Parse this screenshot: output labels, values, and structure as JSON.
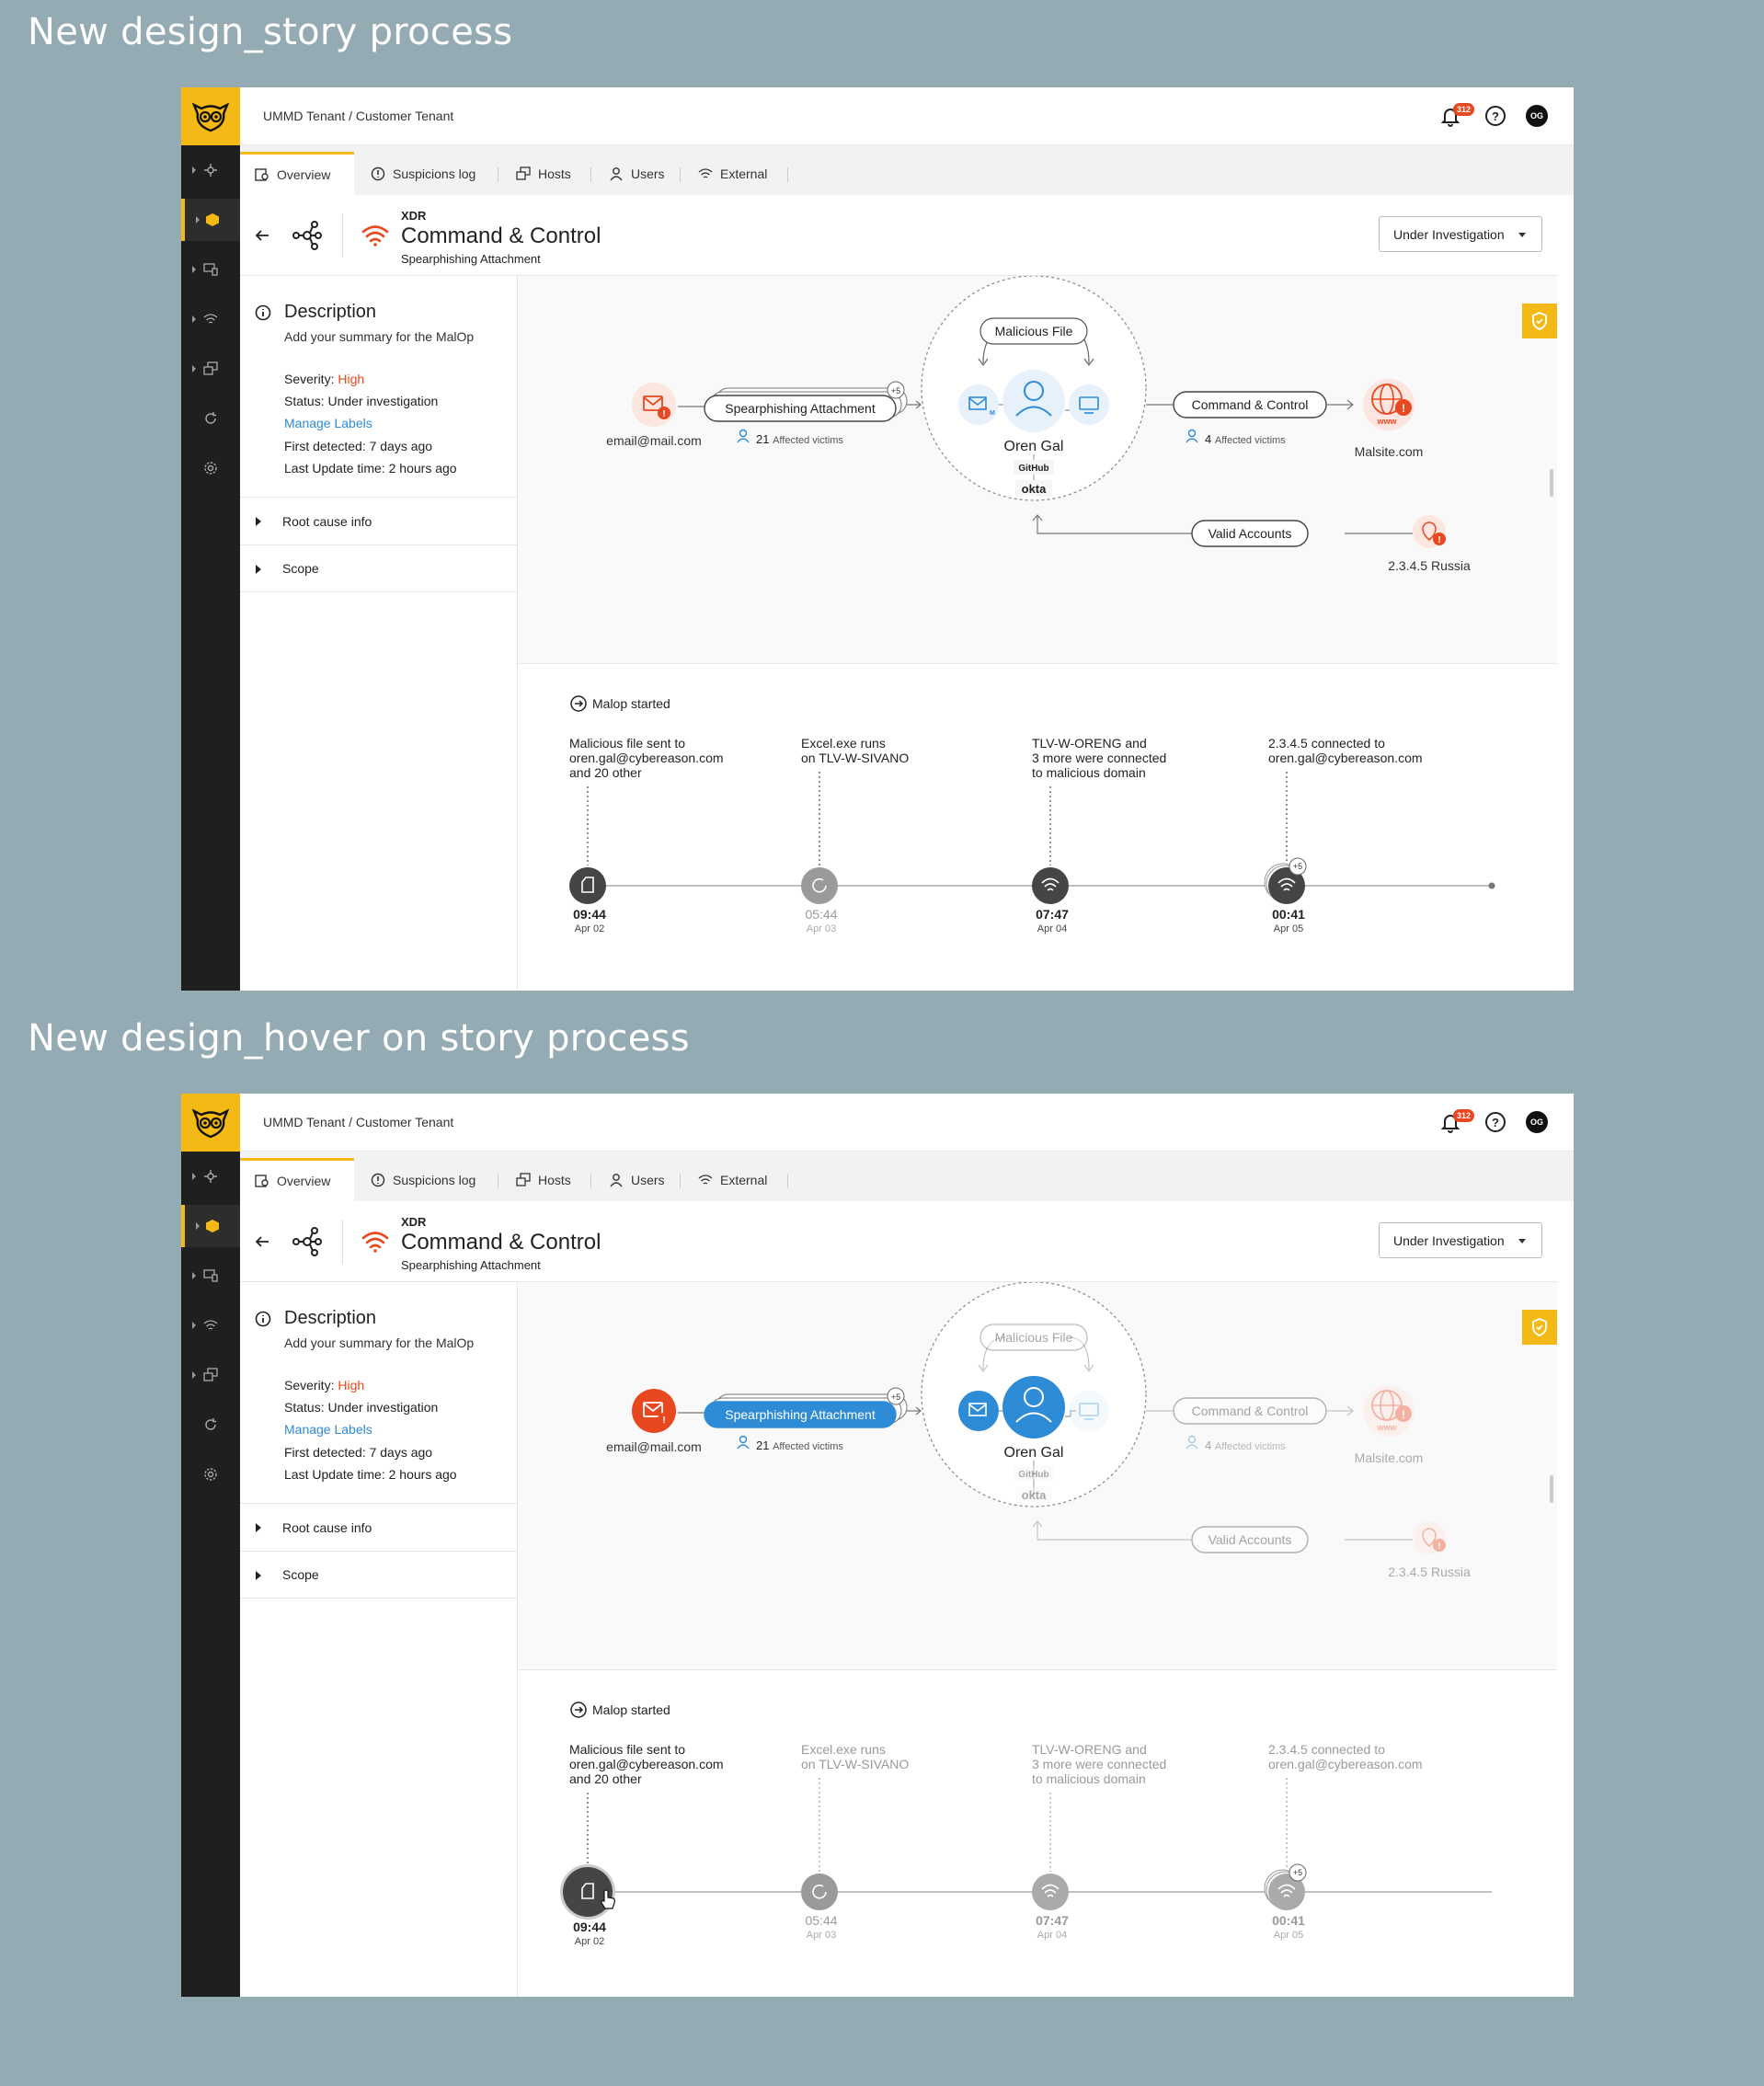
{
  "colors": {
    "accent": "#f5b916",
    "danger": "#e8481f",
    "primary": "#2e8bd6",
    "sidebar": "#1f1f1f",
    "background": "#94abb3"
  },
  "screens": [
    {
      "title": "New design_story process",
      "topbar": {
        "breadcrumb": "UMMD Tenant / Customer Tenant",
        "notifications": "312",
        "avatar": "OG"
      },
      "tabs": [
        "Overview",
        "Suspicions log",
        "Hosts",
        "Users",
        "External"
      ],
      "header": {
        "label": "XDR",
        "title": "Command & Control",
        "subtitle": "Spearphishing Attachment",
        "status": "Under Investigation"
      },
      "description": {
        "title": "Description",
        "summary": "Add your summary for the MalOp",
        "severity_label": "Severity:",
        "severity": "High",
        "status_label": "Status:",
        "status": "Under investigation",
        "manage_labels": "Manage Labels",
        "first_label": "First detected:",
        "first": "7 days ago",
        "last_label": "Last Update time:",
        "last": "2 hours ago",
        "root_cause": "Root cause info",
        "scope": "Scope"
      },
      "graph": {
        "email": "email@mail.com",
        "spear": "Spearphishing Attachment",
        "spear_count": "+5",
        "spear_victims_n": "21",
        "spear_victims": "Affected victims",
        "malicious_file": "Malicious File",
        "user": "Oren Gal",
        "github": "GitHub",
        "okta": "okta",
        "cc": "Command & Control",
        "cc_victims_n": "4",
        "cc_victims": "Affected victims",
        "malsite": "Malsite.com",
        "www": "www",
        "valid": "Valid Accounts",
        "ip": "2.3.4.5 Russia"
      },
      "timeline": {
        "start": "Malop started",
        "events": [
          {
            "text": [
              "Malicious file sent to",
              "oren.gal@cybereason.com",
              "and 20 other"
            ],
            "time": "09:44",
            "date": "Apr 02"
          },
          {
            "text": [
              "Excel.exe runs",
              "on TLV-W-SIVANO"
            ],
            "time": "05:44",
            "date": "Apr 03"
          },
          {
            "text": [
              "TLV-W-ORENG and",
              "3 more were connected",
              "to malicious domain"
            ],
            "time": "07:47",
            "date": "Apr 04"
          },
          {
            "text": [
              "2.3.4.5 connected to",
              "oren.gal@cybereason.com"
            ],
            "time": "00:41",
            "date": "Apr 05",
            "badge": "+5"
          }
        ]
      }
    },
    {
      "title": "New design_hover on story process",
      "topbar": {
        "breadcrumb": "UMMD Tenant / Customer Tenant",
        "notifications": "312",
        "avatar": "OG"
      },
      "tabs": [
        "Overview",
        "Suspicions log",
        "Hosts",
        "Users",
        "External"
      ],
      "header": {
        "label": "XDR",
        "title": "Command & Control",
        "subtitle": "Spearphishing Attachment",
        "status": "Under Investigation"
      },
      "description": {
        "title": "Description",
        "summary": "Add your summary for the MalOp",
        "severity_label": "Severity:",
        "severity": "High",
        "status_label": "Status:",
        "status": "Under investigation",
        "manage_labels": "Manage Labels",
        "first_label": "First detected:",
        "first": "7 days ago",
        "last_label": "Last Update time:",
        "last": "2 hours ago",
        "root_cause": "Root cause info",
        "scope": "Scope"
      },
      "graph": {
        "email": "email@mail.com",
        "spear": "Spearphishing Attachment",
        "spear_count": "+5",
        "spear_victims_n": "21",
        "spear_victims": "Affected victims",
        "malicious_file": "Malicious File",
        "user": "Oren Gal",
        "github": "GitHub",
        "okta": "okta",
        "cc": "Command & Control",
        "cc_victims_n": "4",
        "cc_victims": "Affected victims",
        "malsite": "Malsite.com",
        "www": "www",
        "valid": "Valid Accounts",
        "ip": "2.3.4.5 Russia"
      },
      "timeline": {
        "start": "Malop started",
        "events": [
          {
            "text": [
              "Malicious file sent to",
              "oren.gal@cybereason.com",
              "and 20 other"
            ],
            "time": "09:44",
            "date": "Apr 02"
          },
          {
            "text": [
              "Excel.exe runs",
              "on TLV-W-SIVANO"
            ],
            "time": "05:44",
            "date": "Apr 03"
          },
          {
            "text": [
              "TLV-W-ORENG and",
              "3 more were connected",
              "to malicious domain"
            ],
            "time": "07:47",
            "date": "Apr 04"
          },
          {
            "text": [
              "2.3.4.5 connected to",
              "oren.gal@cybereason.com"
            ],
            "time": "00:41",
            "date": "Apr 05",
            "badge": "+5"
          }
        ]
      }
    }
  ]
}
